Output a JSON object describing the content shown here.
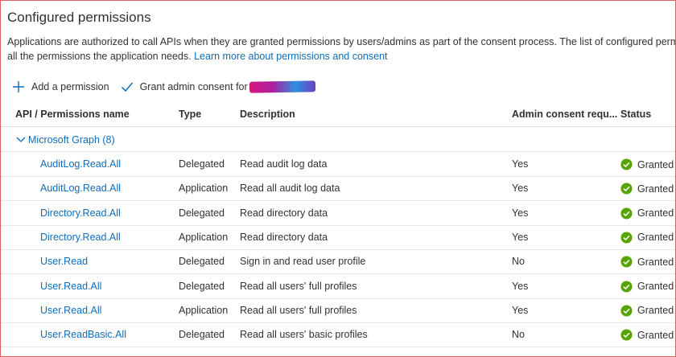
{
  "title": "Configured permissions",
  "description": {
    "line1": "Applications are authorized to call APIs when they are granted permissions by users/admins as part of the consent process. The list of configured permissions should include",
    "line2_text": "all the permissions the application needs. ",
    "learn_more": "Learn more about permissions and consent"
  },
  "toolbar": {
    "add_label": "Add a permission",
    "grant_label": "Grant admin consent for"
  },
  "table": {
    "headers": [
      "API / Permissions name",
      "Type",
      "Description",
      "Admin consent requ...",
      "Status"
    ],
    "group_label": "Microsoft Graph (8)",
    "rows": [
      {
        "name": "AuditLog.Read.All",
        "type": "Delegated",
        "description": "Read audit log data",
        "admin": "Yes",
        "status": "Granted"
      },
      {
        "name": "AuditLog.Read.All",
        "type": "Application",
        "description": "Read all audit log data",
        "admin": "Yes",
        "status": "Granted"
      },
      {
        "name": "Directory.Read.All",
        "type": "Delegated",
        "description": "Read directory data",
        "admin": "Yes",
        "status": "Granted"
      },
      {
        "name": "Directory.Read.All",
        "type": "Application",
        "description": "Read directory data",
        "admin": "Yes",
        "status": "Granted"
      },
      {
        "name": "User.Read",
        "type": "Delegated",
        "description": "Sign in and read user profile",
        "admin": "No",
        "status": "Granted"
      },
      {
        "name": "User.Read.All",
        "type": "Delegated",
        "description": "Read all users' full profiles",
        "admin": "Yes",
        "status": "Granted"
      },
      {
        "name": "User.Read.All",
        "type": "Application",
        "description": "Read all users' full profiles",
        "admin": "Yes",
        "status": "Granted"
      },
      {
        "name": "User.ReadBasic.All",
        "type": "Delegated",
        "description": "Read all users' basic profiles",
        "admin": "No",
        "status": "Granted"
      }
    ]
  },
  "colors": {
    "accent": "#0f6cbd",
    "granted": "#57a300",
    "frame": "#e06060"
  },
  "icons": {
    "add": "plus-icon",
    "grant": "checkmark-icon",
    "group": "chevron-down-icon",
    "status": "check-circle-icon"
  }
}
